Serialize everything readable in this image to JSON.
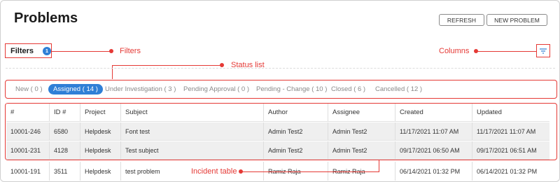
{
  "page": {
    "title": "Problems"
  },
  "toolbar": {
    "refresh_label": "REFRESH",
    "new_problem_label": "NEW PROBLEM"
  },
  "filters": {
    "label": "Filters",
    "count": "1"
  },
  "annotations": {
    "filters": "Filters",
    "columns": "Columns",
    "status_list": "Status list",
    "incident_table": "Incident table"
  },
  "columns_button": {
    "icon": "filter-lines-icon"
  },
  "statuses": [
    {
      "label": "New ( 0 )",
      "active": false
    },
    {
      "label": "Assigned ( 14 )",
      "active": true
    },
    {
      "label": "Under Investigation ( 3 )",
      "active": false
    },
    {
      "label": "Pending Approval ( 0 )",
      "active": false
    },
    {
      "label": "Pending - Change ( 10 )",
      "active": false
    },
    {
      "label": "Closed ( 6 )",
      "active": false
    },
    {
      "label": "Cancelled ( 12 )",
      "active": false
    }
  ],
  "table": {
    "headers": [
      "#",
      "ID #",
      "Project",
      "Subject",
      "Author",
      "Assignee",
      "Created",
      "Updated"
    ],
    "rows": [
      [
        "10001-246",
        "6580",
        "Helpdesk",
        "Font test",
        "Admin Test2",
        "Admin Test2",
        "11/17/2021 11:07 AM",
        "11/17/2021 11:07 AM"
      ],
      [
        "10001-231",
        "4128",
        "Helpdesk",
        "Test subject",
        "Admin Test2",
        "Admin Test2",
        "09/17/2021 06:50 AM",
        "09/17/2021 06:51 AM"
      ],
      [
        "10001-191",
        "3511",
        "Helpdesk",
        "test problem",
        "Ramiz Raja",
        "Ramiz Raja",
        "06/14/2021 01:32 PM",
        "06/14/2021 01:32 PM"
      ]
    ]
  },
  "colors": {
    "accent": "#2f7fd6",
    "annotation": "#e53935",
    "row_highlight": "#efefef"
  }
}
